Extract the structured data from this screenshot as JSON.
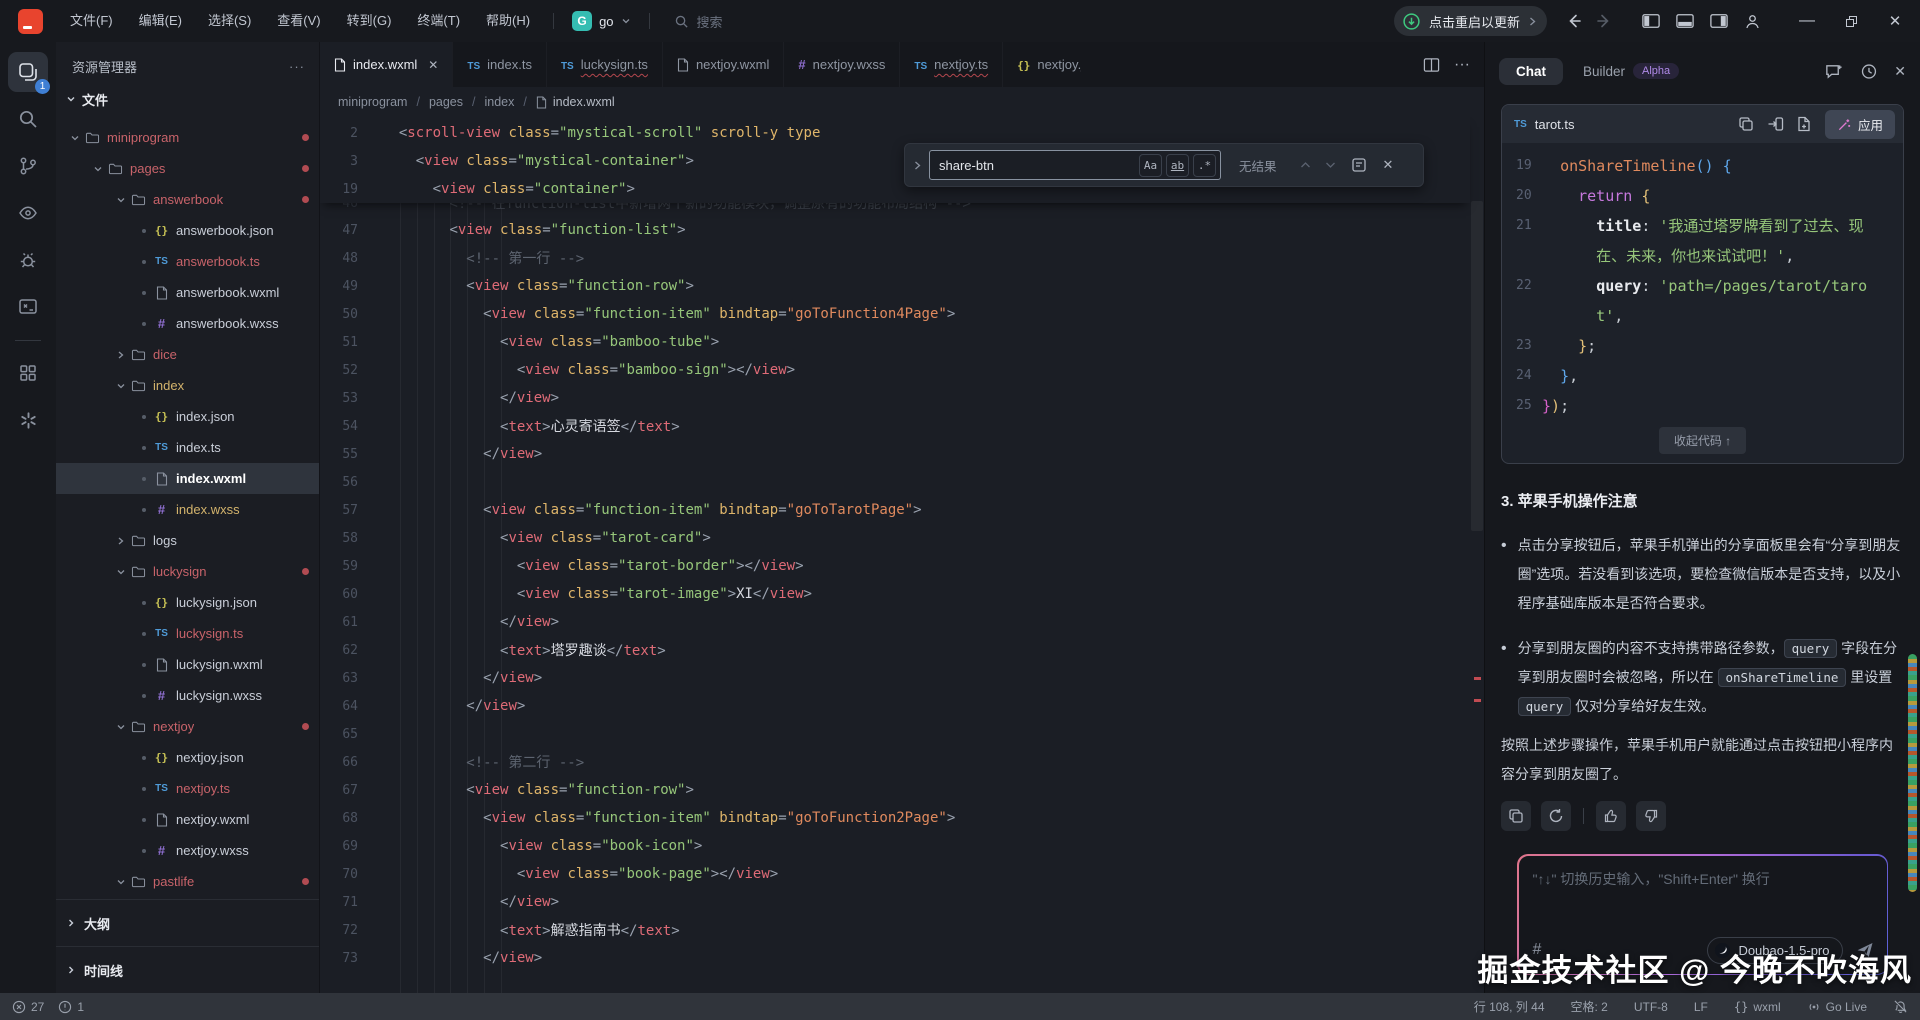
{
  "titlebar": {
    "menus": [
      "文件(F)",
      "编辑(E)",
      "选择(S)",
      "查看(V)",
      "转到(G)",
      "终端(T)",
      "帮助(H)"
    ],
    "project": {
      "initial": "G",
      "name": "go"
    },
    "search_label": "搜索",
    "update_label": "点击重启以更新"
  },
  "sidebar": {
    "title": "资源管理器",
    "section": "文件",
    "outline_label": "大纲",
    "timeline_label": "时间线",
    "tree": [
      {
        "k": "folder",
        "d": 1,
        "n": "miniprogram",
        "c": "red",
        "exp": true,
        "dot": true
      },
      {
        "k": "folder",
        "d": 2,
        "n": "pages",
        "c": "red",
        "exp": true,
        "dot": true
      },
      {
        "k": "folder",
        "d": 3,
        "n": "answerbook",
        "c": "red",
        "exp": true,
        "dot": true
      },
      {
        "k": "file",
        "d": 4,
        "n": "answerbook.json",
        "i": "json"
      },
      {
        "k": "file",
        "d": 4,
        "n": "answerbook.ts",
        "i": "ts",
        "c": "red",
        "sq": true
      },
      {
        "k": "file",
        "d": 4,
        "n": "answerbook.wxml",
        "i": "doc"
      },
      {
        "k": "file",
        "d": 4,
        "n": "answerbook.wxss",
        "i": "hash"
      },
      {
        "k": "folder",
        "d": 3,
        "n": "dice",
        "c": "red",
        "exp": false
      },
      {
        "k": "folder",
        "d": 3,
        "n": "index",
        "c": "yellow",
        "exp": true
      },
      {
        "k": "file",
        "d": 4,
        "n": "index.json",
        "i": "json"
      },
      {
        "k": "file",
        "d": 4,
        "n": "index.ts",
        "i": "ts"
      },
      {
        "k": "file",
        "d": 4,
        "n": "index.wxml",
        "i": "doc",
        "sel": true
      },
      {
        "k": "file",
        "d": 4,
        "n": "index.wxss",
        "i": "hash",
        "c": "yellow"
      },
      {
        "k": "folder",
        "d": 3,
        "n": "logs",
        "exp": false
      },
      {
        "k": "folder",
        "d": 3,
        "n": "luckysign",
        "c": "red",
        "exp": true,
        "dot": true
      },
      {
        "k": "file",
        "d": 4,
        "n": "luckysign.json",
        "i": "json"
      },
      {
        "k": "file",
        "d": 4,
        "n": "luckysign.ts",
        "i": "ts",
        "c": "red",
        "sq": true
      },
      {
        "k": "file",
        "d": 4,
        "n": "luckysign.wxml",
        "i": "doc"
      },
      {
        "k": "file",
        "d": 4,
        "n": "luckysign.wxss",
        "i": "hash"
      },
      {
        "k": "folder",
        "d": 3,
        "n": "nextjoy",
        "c": "red",
        "exp": true,
        "dot": true
      },
      {
        "k": "file",
        "d": 4,
        "n": "nextjoy.json",
        "i": "json"
      },
      {
        "k": "file",
        "d": 4,
        "n": "nextjoy.ts",
        "i": "ts",
        "c": "red",
        "sq": true
      },
      {
        "k": "file",
        "d": 4,
        "n": "nextjoy.wxml",
        "i": "doc"
      },
      {
        "k": "file",
        "d": 4,
        "n": "nextjoy.wxss",
        "i": "hash"
      },
      {
        "k": "folder",
        "d": 3,
        "n": "pastlife",
        "c": "red",
        "exp": true,
        "dot": true
      }
    ]
  },
  "editor": {
    "tabs": [
      {
        "icon": "doc",
        "label": "index.wxml",
        "active": true,
        "close": true
      },
      {
        "icon": "ts",
        "label": "index.ts"
      },
      {
        "icon": "ts",
        "label": "luckysign.ts",
        "error": true
      },
      {
        "icon": "doc",
        "label": "nextjoy.wxml"
      },
      {
        "icon": "hash",
        "label": "nextjoy.wxss"
      },
      {
        "icon": "ts",
        "label": "nextjoy.ts",
        "error": true
      },
      {
        "icon": "json",
        "label": "nextjoy.json",
        "clipped": true
      }
    ],
    "breadcrumb": [
      "miniprogram",
      "pages",
      "index"
    ],
    "breadcrumb_file": "index.wxml",
    "sticky_lines": [
      {
        "n": 2,
        "t": "  <scroll-view class=\"mystical-scroll\" scroll-y type"
      },
      {
        "n": 3,
        "t": "    <view class=\"mystical-container\">"
      },
      {
        "n": 19,
        "t": "      <view class=\"container\">"
      }
    ],
    "partial_line": {
      "n": 46,
      "t": "        <!-- 在function-list中新增两个新的功能模块，调整原有的功能布局结构 -->"
    },
    "lines": [
      {
        "n": 47,
        "t": "        <view class=\"function-list\">"
      },
      {
        "n": 48,
        "t": "          <!-- 第一行 -->"
      },
      {
        "n": 49,
        "t": "          <view class=\"function-row\">"
      },
      {
        "n": 50,
        "t": "            <view class=\"function-item\" bindtap=\"goToFunction4Page\">"
      },
      {
        "n": 51,
        "t": "              <view class=\"bamboo-tube\">"
      },
      {
        "n": 52,
        "t": "                <view class=\"bamboo-sign\"></view>"
      },
      {
        "n": 53,
        "t": "              </view>"
      },
      {
        "n": 54,
        "t": "              <text>心灵寄语签</text>"
      },
      {
        "n": 55,
        "t": "            </view>"
      },
      {
        "n": 56,
        "t": ""
      },
      {
        "n": 57,
        "t": "            <view class=\"function-item\" bindtap=\"goToTarotPage\">"
      },
      {
        "n": 58,
        "t": "              <view class=\"tarot-card\">"
      },
      {
        "n": 59,
        "t": "                <view class=\"tarot-border\"></view>"
      },
      {
        "n": 60,
        "t": "                <view class=\"tarot-image\">XI</view>"
      },
      {
        "n": 61,
        "t": "              </view>"
      },
      {
        "n": 62,
        "t": "              <text>塔罗趣谈</text>"
      },
      {
        "n": 63,
        "t": "            </view>"
      },
      {
        "n": 64,
        "t": "          </view>"
      },
      {
        "n": 65,
        "t": ""
      },
      {
        "n": 66,
        "t": "          <!-- 第二行 -->"
      },
      {
        "n": 67,
        "t": "          <view class=\"function-row\">"
      },
      {
        "n": 68,
        "t": "            <view class=\"function-item\" bindtap=\"goToFunction2Page\">"
      },
      {
        "n": 69,
        "t": "              <view class=\"book-icon\">"
      },
      {
        "n": 70,
        "t": "                <view class=\"book-page\"></view>"
      },
      {
        "n": 71,
        "t": "              </view>"
      },
      {
        "n": 72,
        "t": "              <text>解惑指南书</text>"
      },
      {
        "n": 73,
        "t": "            </view>"
      }
    ],
    "search": {
      "value": "share-btn",
      "case_btn": "Aa",
      "word_btn": "ab",
      "regex_btn": ".*",
      "result": "无结果"
    }
  },
  "chat": {
    "tabs": {
      "chat": "Chat",
      "builder": "Builder",
      "alpha": "Alpha"
    },
    "code_card": {
      "lang": "TS",
      "filename": "tarot.ts",
      "apply_label": "应用",
      "collapse_label": "收起代码 ↑",
      "lines": [
        {
          "n": 19,
          "toks": [
            [
              "  ",
              ""
            ],
            [
              "onShareTimeline",
              "fn"
            ],
            [
              "()",
              "b1"
            ],
            [
              " ",
              ""
            ],
            [
              "{",
              "b1"
            ]
          ]
        },
        {
          "n": 20,
          "toks": [
            [
              "    ",
              ""
            ],
            [
              "return",
              "kw"
            ],
            [
              " ",
              ""
            ],
            [
              "{",
              "yb"
            ]
          ]
        },
        {
          "n": 21,
          "toks": [
            [
              "      ",
              ""
            ],
            [
              "title",
              "pr"
            ],
            [
              ": ",
              "pl"
            ],
            [
              "'我通过塔罗牌看到了过去、现在、未来，你也来试试吧！'",
              "st"
            ],
            [
              ",",
              "pl"
            ]
          ]
        },
        {
          "n": 22,
          "toks": [
            [
              "      ",
              ""
            ],
            [
              "query",
              "pr"
            ],
            [
              ": ",
              "pl"
            ],
            [
              "'path=/pages/tarot/tarot'",
              "st"
            ],
            [
              ",",
              "pl"
            ]
          ]
        },
        {
          "n": 23,
          "toks": [
            [
              "    ",
              ""
            ],
            [
              "}",
              "yb"
            ],
            [
              ";",
              "pl"
            ]
          ]
        },
        {
          "n": 24,
          "toks": [
            [
              "  ",
              ""
            ],
            [
              "}",
              "b1"
            ],
            [
              ",",
              "pl"
            ]
          ]
        },
        {
          "n": 25,
          "toks": [
            [
              "}",
              "mg"
            ],
            [
              ")",
              "yb"
            ],
            [
              ";",
              "pl"
            ]
          ]
        }
      ]
    },
    "message": {
      "heading": "3. 苹果手机操作注意",
      "bullets": [
        [
          {
            "t": "点击分享按钮后，苹果手机弹出的分享面板里会有“分享到朋友圈”选项。若没看到该选项，要检查微信版本是否支持，以及小程序基础库版本是否符合要求。"
          }
        ],
        [
          {
            "t": "分享到朋友圈的内容不支持携带路径参数，"
          },
          {
            "c": "query"
          },
          {
            "t": " 字段在分享到朋友圈时会被忽略，所以在 "
          },
          {
            "c": "onShareTimeline"
          },
          {
            "t": " 里设置 "
          },
          {
            "c": "query"
          },
          {
            "t": " 仅对分享给好友生效。"
          }
        ]
      ],
      "closing": "按照上述步骤操作，苹果手机用户就能通过点击按钮把小程序内容分享到朋友圈了。"
    },
    "input": {
      "placeholder": "\"↑↓\" 切换历史输入，\"Shift+Enter\" 换行",
      "hash": "#",
      "model": "Doubao-1.5-pro"
    }
  },
  "status_bar": {
    "errors": "27",
    "warnings": "1",
    "cursor": "行 108, 列 44",
    "indent": "空格: 2",
    "encoding": "UTF-8",
    "eol": "LF",
    "lang": "wxml",
    "golive": "Go Live"
  },
  "watermark": "掘金技术社区 @ 今晚不吹海风"
}
